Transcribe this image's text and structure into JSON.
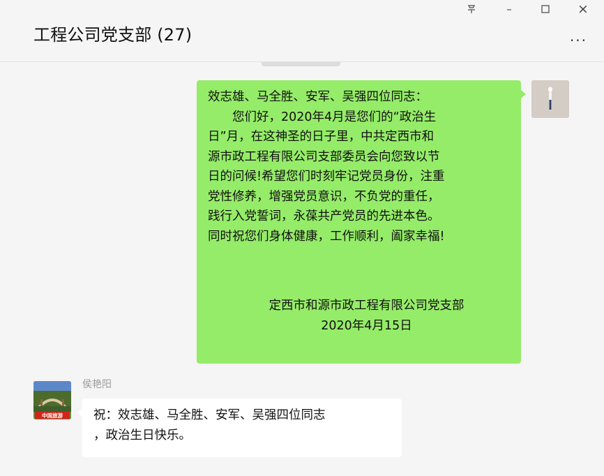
{
  "window": {
    "title": "工程公司党支部 (27)",
    "pin_glyph": "",
    "minimize_glyph": "–",
    "maximize_glyph": "☐",
    "close_glyph": "×",
    "more_glyph": "..."
  },
  "messages": {
    "outgoing": {
      "lines": [
        "效志雄、马全胜、安军、吴强四位同志：",
        "　　您们好，2020年4月是您们的“政治生",
        "日”月，在这神圣的日子里，中共定西市和",
        "源市政工程有限公司支部委员会向您致以节",
        "日的问候!希望您们时刻牢记党员身份，注重",
        "党性修养，增强党员意识，不负党的重任，",
        "践行入党誓词，永葆共产党员的先进本色。",
        "同时祝您们身体健康，工作顺利，阖家幸福!"
      ],
      "signature_org": "定西市和源市政工程有限公司党支部",
      "signature_date": "2020年4月15日",
      "bubble_color": "#95ec69"
    },
    "incoming": {
      "sender": "侯艳阳",
      "lines": [
        "祝：效志雄、马全胜、安军、吴强四位同志",
        "，政治生日快乐。"
      ],
      "avatar_badge": "中国旅游",
      "bubble_color": "#ffffff"
    }
  },
  "colors": {
    "background": "#f5f5f5",
    "accent_green": "#95ec69"
  },
  "icons": {
    "pin": "pin-icon",
    "minimize": "minimize-icon",
    "maximize": "maximize-icon",
    "close": "close-icon",
    "more": "more-options-icon"
  }
}
